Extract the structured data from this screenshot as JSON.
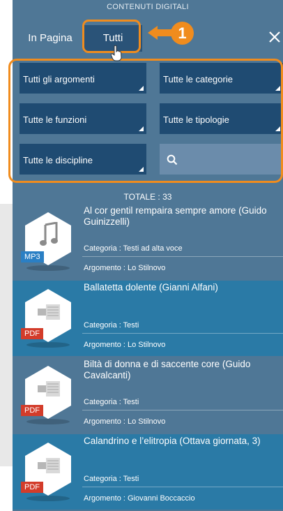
{
  "header": {
    "title": "CONTENUTI DIGITALI"
  },
  "tabs": [
    {
      "label": "In Pagina"
    },
    {
      "label": "Tutti"
    }
  ],
  "callout": {
    "number": "1"
  },
  "filters": [
    {
      "label": "Tutti gli argomenti"
    },
    {
      "label": "Tutte le categorie"
    },
    {
      "label": "Tutte le funzioni"
    },
    {
      "label": "Tutte le tipologie"
    },
    {
      "label": "Tutte le discipline"
    }
  ],
  "totale": "TOTALE : 33",
  "items": [
    {
      "title": "Al cor gentil rempaira sempre amore (Guido Guinizzelli)",
      "categoria": "Categoria : Testi ad alta voce",
      "argomento": "Argomento : Lo Stilnovo",
      "badge": "MP3",
      "icon": "music-note-icon"
    },
    {
      "title": "Ballatetta dolente (Gianni Alfani)",
      "categoria": "Categoria : Testi",
      "argomento": "Argomento : Lo Stilnovo",
      "badge": "PDF",
      "icon": "document-icon"
    },
    {
      "title": "Biltà di donna e di saccente core (Guido Cavalcanti)",
      "categoria": "Categoria : Testi",
      "argomento": "Argomento : Lo Stilnovo",
      "badge": "PDF",
      "icon": "document-icon"
    },
    {
      "title": "Calandrino e l’elitropia (Ottava giornata, 3)",
      "categoria": "Categoria : Testi",
      "argomento": "Argomento : Giovanni Boccaccio",
      "badge": "PDF",
      "icon": "document-icon"
    }
  ],
  "colors": {
    "accent": "#f08c1e",
    "panel": "#4f7796",
    "button": "#1f4b72",
    "selected": "#2a7aa6",
    "mp3": "#2a7fc4",
    "pdf": "#d33c2a"
  }
}
